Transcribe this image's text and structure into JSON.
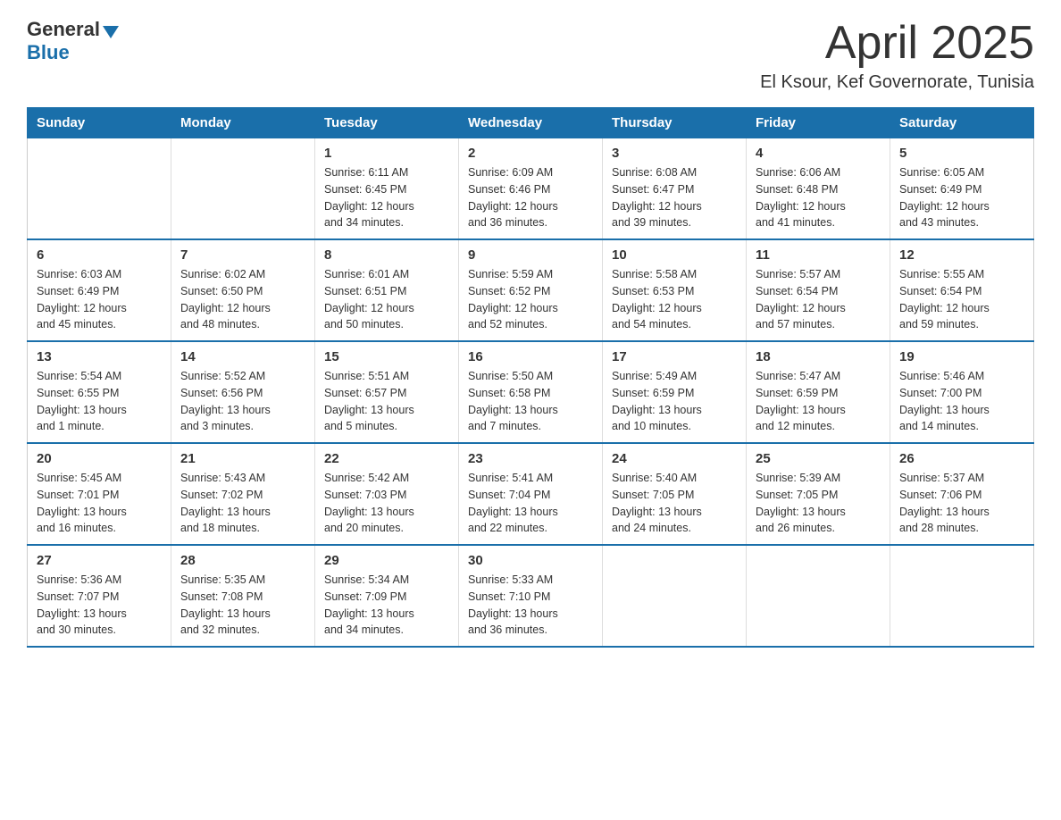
{
  "header": {
    "logo": {
      "general": "General",
      "blue": "Blue"
    },
    "title": "April 2025",
    "subtitle": "El Ksour, Kef Governorate, Tunisia"
  },
  "calendar": {
    "days_of_week": [
      "Sunday",
      "Monday",
      "Tuesday",
      "Wednesday",
      "Thursday",
      "Friday",
      "Saturday"
    ],
    "weeks": [
      [
        {
          "day": "",
          "info": ""
        },
        {
          "day": "",
          "info": ""
        },
        {
          "day": "1",
          "info": "Sunrise: 6:11 AM\nSunset: 6:45 PM\nDaylight: 12 hours\nand 34 minutes."
        },
        {
          "day": "2",
          "info": "Sunrise: 6:09 AM\nSunset: 6:46 PM\nDaylight: 12 hours\nand 36 minutes."
        },
        {
          "day": "3",
          "info": "Sunrise: 6:08 AM\nSunset: 6:47 PM\nDaylight: 12 hours\nand 39 minutes."
        },
        {
          "day": "4",
          "info": "Sunrise: 6:06 AM\nSunset: 6:48 PM\nDaylight: 12 hours\nand 41 minutes."
        },
        {
          "day": "5",
          "info": "Sunrise: 6:05 AM\nSunset: 6:49 PM\nDaylight: 12 hours\nand 43 minutes."
        }
      ],
      [
        {
          "day": "6",
          "info": "Sunrise: 6:03 AM\nSunset: 6:49 PM\nDaylight: 12 hours\nand 45 minutes."
        },
        {
          "day": "7",
          "info": "Sunrise: 6:02 AM\nSunset: 6:50 PM\nDaylight: 12 hours\nand 48 minutes."
        },
        {
          "day": "8",
          "info": "Sunrise: 6:01 AM\nSunset: 6:51 PM\nDaylight: 12 hours\nand 50 minutes."
        },
        {
          "day": "9",
          "info": "Sunrise: 5:59 AM\nSunset: 6:52 PM\nDaylight: 12 hours\nand 52 minutes."
        },
        {
          "day": "10",
          "info": "Sunrise: 5:58 AM\nSunset: 6:53 PM\nDaylight: 12 hours\nand 54 minutes."
        },
        {
          "day": "11",
          "info": "Sunrise: 5:57 AM\nSunset: 6:54 PM\nDaylight: 12 hours\nand 57 minutes."
        },
        {
          "day": "12",
          "info": "Sunrise: 5:55 AM\nSunset: 6:54 PM\nDaylight: 12 hours\nand 59 minutes."
        }
      ],
      [
        {
          "day": "13",
          "info": "Sunrise: 5:54 AM\nSunset: 6:55 PM\nDaylight: 13 hours\nand 1 minute."
        },
        {
          "day": "14",
          "info": "Sunrise: 5:52 AM\nSunset: 6:56 PM\nDaylight: 13 hours\nand 3 minutes."
        },
        {
          "day": "15",
          "info": "Sunrise: 5:51 AM\nSunset: 6:57 PM\nDaylight: 13 hours\nand 5 minutes."
        },
        {
          "day": "16",
          "info": "Sunrise: 5:50 AM\nSunset: 6:58 PM\nDaylight: 13 hours\nand 7 minutes."
        },
        {
          "day": "17",
          "info": "Sunrise: 5:49 AM\nSunset: 6:59 PM\nDaylight: 13 hours\nand 10 minutes."
        },
        {
          "day": "18",
          "info": "Sunrise: 5:47 AM\nSunset: 6:59 PM\nDaylight: 13 hours\nand 12 minutes."
        },
        {
          "day": "19",
          "info": "Sunrise: 5:46 AM\nSunset: 7:00 PM\nDaylight: 13 hours\nand 14 minutes."
        }
      ],
      [
        {
          "day": "20",
          "info": "Sunrise: 5:45 AM\nSunset: 7:01 PM\nDaylight: 13 hours\nand 16 minutes."
        },
        {
          "day": "21",
          "info": "Sunrise: 5:43 AM\nSunset: 7:02 PM\nDaylight: 13 hours\nand 18 minutes."
        },
        {
          "day": "22",
          "info": "Sunrise: 5:42 AM\nSunset: 7:03 PM\nDaylight: 13 hours\nand 20 minutes."
        },
        {
          "day": "23",
          "info": "Sunrise: 5:41 AM\nSunset: 7:04 PM\nDaylight: 13 hours\nand 22 minutes."
        },
        {
          "day": "24",
          "info": "Sunrise: 5:40 AM\nSunset: 7:05 PM\nDaylight: 13 hours\nand 24 minutes."
        },
        {
          "day": "25",
          "info": "Sunrise: 5:39 AM\nSunset: 7:05 PM\nDaylight: 13 hours\nand 26 minutes."
        },
        {
          "day": "26",
          "info": "Sunrise: 5:37 AM\nSunset: 7:06 PM\nDaylight: 13 hours\nand 28 minutes."
        }
      ],
      [
        {
          "day": "27",
          "info": "Sunrise: 5:36 AM\nSunset: 7:07 PM\nDaylight: 13 hours\nand 30 minutes."
        },
        {
          "day": "28",
          "info": "Sunrise: 5:35 AM\nSunset: 7:08 PM\nDaylight: 13 hours\nand 32 minutes."
        },
        {
          "day": "29",
          "info": "Sunrise: 5:34 AM\nSunset: 7:09 PM\nDaylight: 13 hours\nand 34 minutes."
        },
        {
          "day": "30",
          "info": "Sunrise: 5:33 AM\nSunset: 7:10 PM\nDaylight: 13 hours\nand 36 minutes."
        },
        {
          "day": "",
          "info": ""
        },
        {
          "day": "",
          "info": ""
        },
        {
          "day": "",
          "info": ""
        }
      ]
    ]
  }
}
